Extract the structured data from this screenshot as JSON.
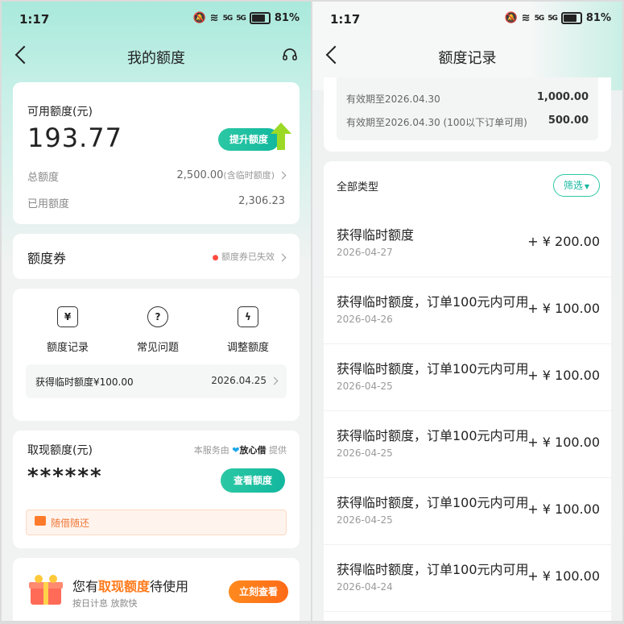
{
  "status": {
    "time": "1:17",
    "battery": "81%",
    "net1": "5G",
    "net2": "5G"
  },
  "left": {
    "title": "我的额度",
    "available": {
      "label": "可用额度(元)",
      "amount": "193.77",
      "raise_btn": "提升额度"
    },
    "total": {
      "label": "总额度",
      "value": "2,500.00",
      "note": "(含临时额度)"
    },
    "used": {
      "label": "已用额度",
      "value": "2,306.23"
    },
    "coupon": {
      "label": "额度券",
      "status": "额度券已失效"
    },
    "shortcuts": [
      {
        "icon": "yen-icon",
        "glyph": "¥",
        "label": "额度记录"
      },
      {
        "icon": "question-icon",
        "glyph": "?",
        "label": "常见问题"
      },
      {
        "icon": "bolt-bag-icon",
        "glyph": "ϟ",
        "label": "调整额度"
      }
    ],
    "latest_record": {
      "text": "获得临时额度¥100.00",
      "date": "2026.04.25"
    },
    "withdraw": {
      "label": "取现额度(元)",
      "provider_prefix": "本服务由",
      "provider": "放心借",
      "provider_suffix": "提供",
      "masked": "******",
      "view_btn": "查看额度",
      "tag": "随借随还"
    },
    "promo": {
      "pre": "您有",
      "highlight": "取现额度",
      "post": "待使用",
      "sub": "按日计息 放款快",
      "btn": "立刻查看"
    }
  },
  "right": {
    "title": "额度记录",
    "validity": [
      {
        "label": "有效期至2026.04.30",
        "value": "1,000.00"
      },
      {
        "label": "有效期至2026.04.30 (100以下订单可用)",
        "value": "500.00"
      }
    ],
    "filter_label": "全部类型",
    "filter_btn": "筛选",
    "records": [
      {
        "title": "获得临时额度",
        "date": "2026-04-27",
        "amount": "+ ¥ 200.00"
      },
      {
        "title": "获得临时额度，订单100元内可用",
        "date": "2026-04-26",
        "amount": "+ ¥ 100.00"
      },
      {
        "title": "获得临时额度，订单100元内可用",
        "date": "2026-04-25",
        "amount": "+ ¥ 100.00"
      },
      {
        "title": "获得临时额度，订单100元内可用",
        "date": "2026-04-25",
        "amount": "+ ¥ 100.00"
      },
      {
        "title": "获得临时额度，订单100元内可用",
        "date": "2026-04-25",
        "amount": "+ ¥ 100.00"
      },
      {
        "title": "获得临时额度，订单100元内可用",
        "date": "2026-04-24",
        "amount": "+ ¥ 100.00"
      }
    ]
  }
}
